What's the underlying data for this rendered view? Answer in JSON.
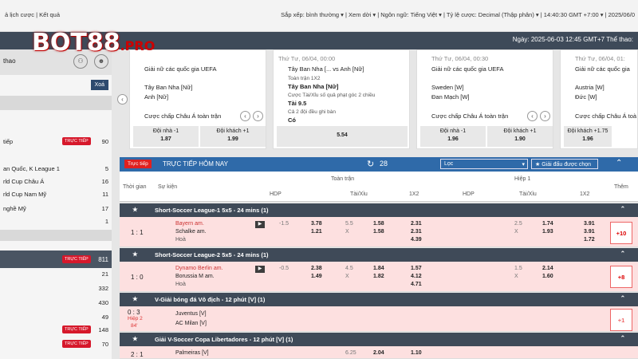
{
  "topbar": {
    "left": "ả lịch cược  |  Kết quả",
    "right": "Sắp xếp: bình thường ▾  |  Xem dời ▾  |  Ngôn ngữ: Tiếng Việt ▾  |  Tỷ lệ cược: Decimal (Thập phân) ▾  |  14:40:30 GMT +7:00 ▾  |  2025/06/0"
  },
  "logo": {
    "main": "BOT88",
    "suffix": ".PRO"
  },
  "darkbar": {
    "time": "Ngày: 2025-06-03 12:45 GMT+7 Thể thao:"
  },
  "sidebar": {
    "tab": "thao",
    "clear": "Xoá",
    "badge": "TRỰC TIẾP",
    "rows": [
      {
        "label": "tiếp",
        "num": "90",
        "live": true
      },
      {
        "label": "an Quốc, K League 1",
        "num": "5",
        "live": false
      },
      {
        "label": "rld Cup Châu Á",
        "num": "16",
        "live": false
      },
      {
        "label": "rld Cup Nam Mỹ",
        "num": "11",
        "live": false
      },
      {
        "label": "nghề Mỹ",
        "num": "17",
        "live": false
      },
      {
        "label": "",
        "num": "1",
        "live": false
      }
    ],
    "rows2": [
      {
        "num": "811",
        "live": true
      },
      {
        "num": "21",
        "live": false
      },
      {
        "num": "332",
        "live": false
      },
      {
        "num": "430",
        "live": false
      },
      {
        "num": "49",
        "live": false
      },
      {
        "num": "148",
        "live": true
      },
      {
        "num": "70",
        "live": true
      }
    ]
  },
  "cards": [
    {
      "date": "",
      "league": "Giải nữ các quốc gia UEFA",
      "t1": "Tây Ban Nha [Nữ]",
      "t2": "Anh [Nữ]",
      "market": "Cược chấp Châu Á toàn trận",
      "o1l": "Đội nhà -1",
      "o1v": "1.87",
      "o2l": "Đội khách +1",
      "o2v": "1.99"
    },
    {
      "date": "Thứ Tư, 06/04, 00:00",
      "league": "Tây Ban Nha [... vs Anh [Nữ]",
      "t1": "Toàn trận 1X2",
      "t2": "Tây Ban Nha [Nữ]",
      "market": "Cược Tài/Xỉu số quả phạt góc 2 chiều",
      "extra1": "Tài 9.5",
      "extra2": "Cả 2 đội đều ghi bàn",
      "extra3": "Có",
      "odds": "5.54"
    },
    {
      "date": "Thứ Tư, 06/04, 00:30",
      "league": "Giải nữ các quốc gia UEFA",
      "t1": "Sweden [W]",
      "t2": "Đan Mạch [W]",
      "market": "Cược chấp Châu Á toàn trận",
      "o1l": "Đội nhà -1",
      "o1v": "1.96",
      "o2l": "Đội khách +1",
      "o2v": "1.90"
    },
    {
      "date": "Thứ Tư, 06/04, 01:",
      "league": "Giải nữ các quốc gia",
      "t1": "Austria [W]",
      "t2": "Đức [W]",
      "market": "Cược chấp Châu Á toà",
      "o1l": "Đội nhà -1",
      "o1v": "",
      "o2l": "Đội khách +1.75",
      "o2v": "1.96"
    }
  ],
  "live": {
    "tag": "Trực tiếp",
    "title": "TRỰC TIẾP HÔM NAY",
    "count": "28",
    "filter": "Lọc",
    "selected": "Giải đấu được chọn"
  },
  "cols": {
    "time": "Thời gian",
    "event": "Sự kiện",
    "full": "Toàn trận",
    "half": "Hiệp 1",
    "hdp": "HDP",
    "ou": "Tài/Xỉu",
    "x12": "1X2",
    "more": "Thêm"
  },
  "leagues": [
    {
      "name": "Short-Soccer League-1 5x5 - 24 mins (1)"
    },
    {
      "name": "Short-Soccer League-2 5x5 - 24 mins (1)"
    },
    {
      "name": "V-Giải bóng đá Vô địch - 12 phút [V] (1)"
    },
    {
      "name": "Giải V-Soccer Copa Libertadores - 12 phút [V] (1)"
    }
  ],
  "matches": [
    {
      "score": "1 : 1",
      "home": "Bayern am.",
      "away": "Schalke am.",
      "draw": "Hoà",
      "hcap": "-1.5",
      "h1": "3.78",
      "h2": "1.21",
      "ou": "5.5",
      "oux": "X",
      "o1": "1.58",
      "o2": "1.58",
      "m1": "2.31",
      "m2": "2.31",
      "m3": "4.39",
      "fh": "2.5",
      "fhx": "X",
      "f1": "1.74",
      "f2": "1.93",
      "fm1": "3.91",
      "fm2": "3.91",
      "fm3": "1.72",
      "more": "+10"
    },
    {
      "score": "1 : 0",
      "home": "Dynamo Berlin am.",
      "away": "Borussia M am.",
      "draw": "Hoà",
      "hcap": "-0.5",
      "h1": "2.38",
      "h2": "1.49",
      "ou": "4.5",
      "oux": "X",
      "o1": "1.84",
      "o2": "1.82",
      "m1": "1.57",
      "m2": "4.12",
      "m3": "4.71",
      "fh": "1.5",
      "fhx": "X",
      "f1": "2.14",
      "f2": "1.60",
      "fm1": "",
      "fm2": "",
      "fm3": "",
      "more": "+8"
    },
    {
      "score": "0 : 3",
      "period": "Hiệp 2",
      "minute": "84'",
      "home": "Juventus [V]",
      "away": "AC Milan [V]",
      "more": "+1"
    },
    {
      "score": "2 : 1",
      "home": "Palmeiras [V]",
      "ou": "6.25",
      "o1": "2.04",
      "m1": "1.10"
    }
  ]
}
